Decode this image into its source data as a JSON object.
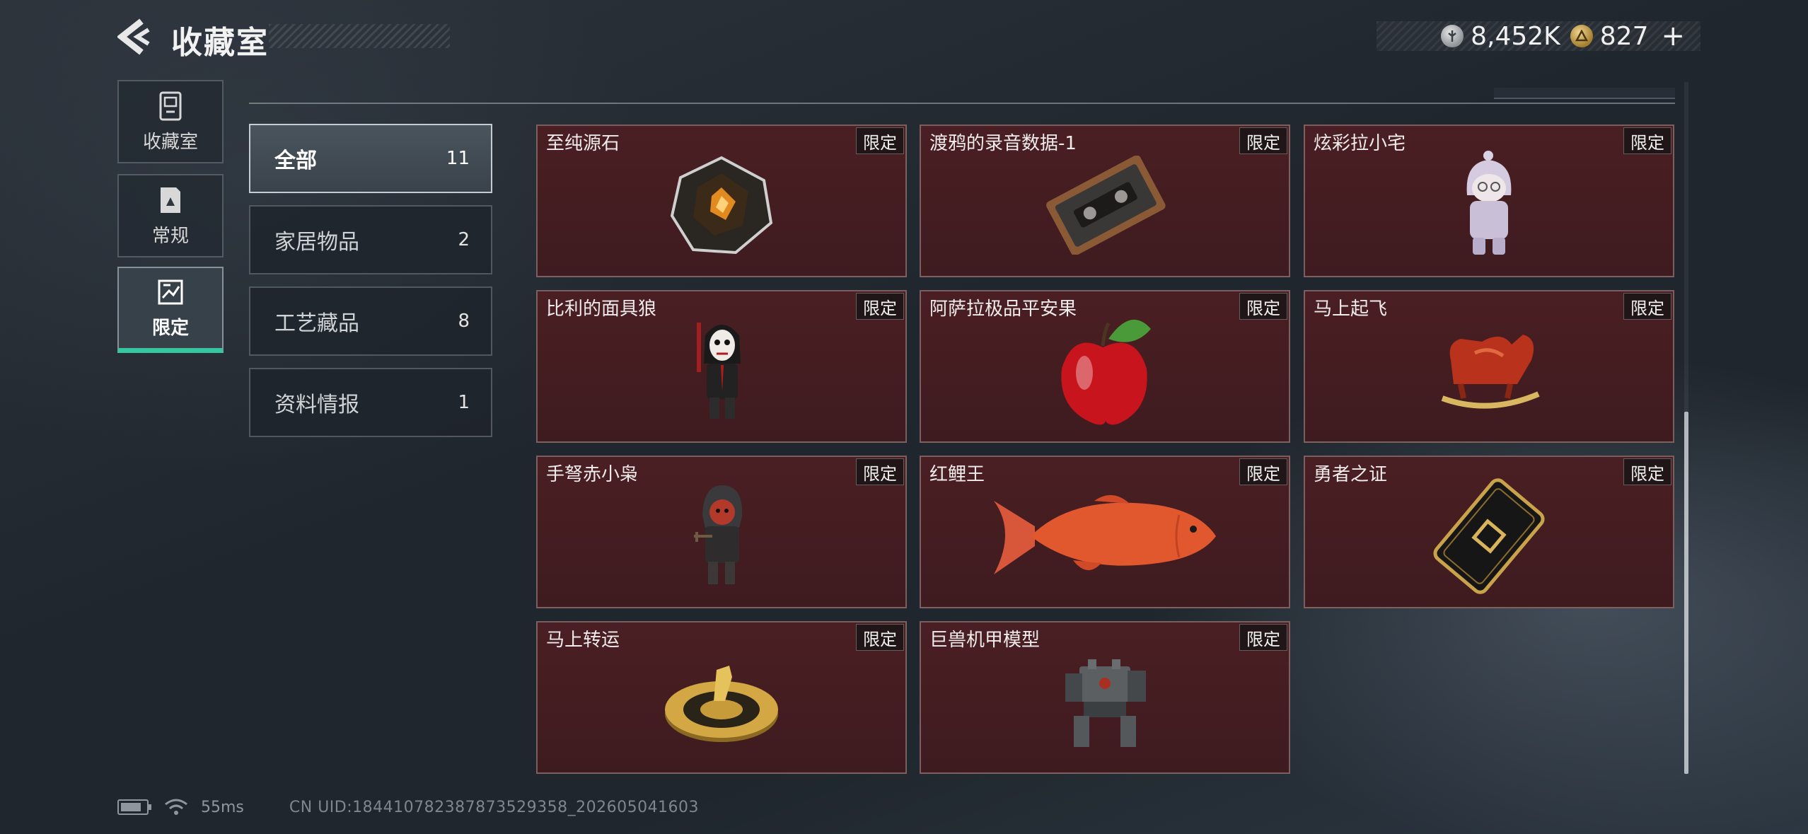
{
  "header": {
    "title": "收藏室",
    "currency_silver": "8,452K",
    "currency_gold": "827"
  },
  "sidebar": {
    "items": [
      {
        "label": "收藏室",
        "icon": "trophy-case-icon"
      },
      {
        "label": "常规",
        "icon": "document-icon"
      },
      {
        "label": "限定",
        "icon": "limited-icon",
        "active": true
      }
    ]
  },
  "categories": [
    {
      "name": "全部",
      "count": "11",
      "active": true
    },
    {
      "name": "家居物品",
      "count": "2"
    },
    {
      "name": "工艺藏品",
      "count": "8"
    },
    {
      "name": "资料情报",
      "count": "1"
    }
  ],
  "items": [
    {
      "name": "至纯源石",
      "badge": "限定",
      "art": "originium-crystal"
    },
    {
      "name": "渡鸦的录音数据-1",
      "badge": "限定",
      "art": "cassette-tape"
    },
    {
      "name": "炫彩拉小宅",
      "badge": "限定",
      "art": "hooded-figurine"
    },
    {
      "name": "比利的面具狼",
      "badge": "限定",
      "art": "masked-puppet"
    },
    {
      "name": "阿萨拉极品平安果",
      "badge": "限定",
      "art": "red-apple"
    },
    {
      "name": "马上起飞",
      "badge": "限定",
      "art": "rocking-horse"
    },
    {
      "name": "手弩赤小枭",
      "badge": "限定",
      "art": "hooded-crossbow-figure"
    },
    {
      "name": "红鲤王",
      "badge": "限定",
      "art": "red-carp"
    },
    {
      "name": "勇者之证",
      "badge": "限定",
      "art": "black-gold-card"
    },
    {
      "name": "马上转运",
      "badge": "限定",
      "art": "golden-horse-wheel"
    },
    {
      "name": "巨兽机甲模型",
      "badge": "限定",
      "art": "mech-model"
    }
  ],
  "status_bar": {
    "ping": "55ms",
    "uid": "CN UID:184410782387873529358_202605041603"
  }
}
